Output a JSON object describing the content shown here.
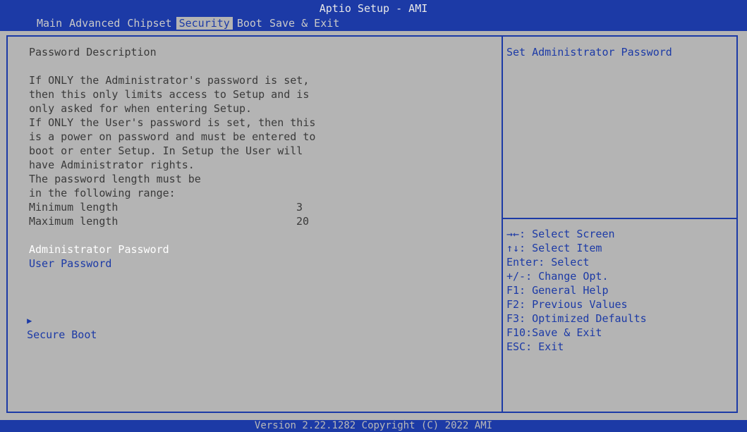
{
  "app": {
    "title": "Aptio Setup - AMI"
  },
  "tabs": [
    "Main",
    "Advanced",
    "Chipset",
    "Security",
    "Boot",
    "Save & Exit"
  ],
  "active_tab": "Security",
  "description": {
    "heading": "Password Description",
    "lines": [
      "If ONLY the Administrator's password is set,",
      "then this only limits access to Setup and is",
      "only asked for when entering Setup.",
      "If ONLY the User's password is set, then this",
      "is a power on password and must be entered to",
      "boot or enter Setup. In Setup the User will",
      "have Administrator rights.",
      "The password length must be",
      "in the following range:"
    ],
    "min_label": "Minimum length",
    "min_value": "3",
    "max_label": "Maximum length",
    "max_value": "20"
  },
  "items": {
    "admin_password": "Administrator Password",
    "user_password": "User Password",
    "secure_boot": "Secure Boot"
  },
  "help_text": "Set Administrator Password",
  "keys": [
    "→←: Select Screen",
    "↑↓: Select Item",
    "Enter: Select",
    "+/-: Change Opt.",
    "F1: General Help",
    "F2: Previous Values",
    "F3: Optimized Defaults",
    "F10:Save & Exit",
    "ESC: Exit"
  ],
  "footer": "Version 2.22.1282 Copyright (C) 2022 AMI",
  "colors": {
    "accent": "#1c3aa6",
    "background": "#b4b4b4",
    "highlight_text": "#ffffff"
  }
}
